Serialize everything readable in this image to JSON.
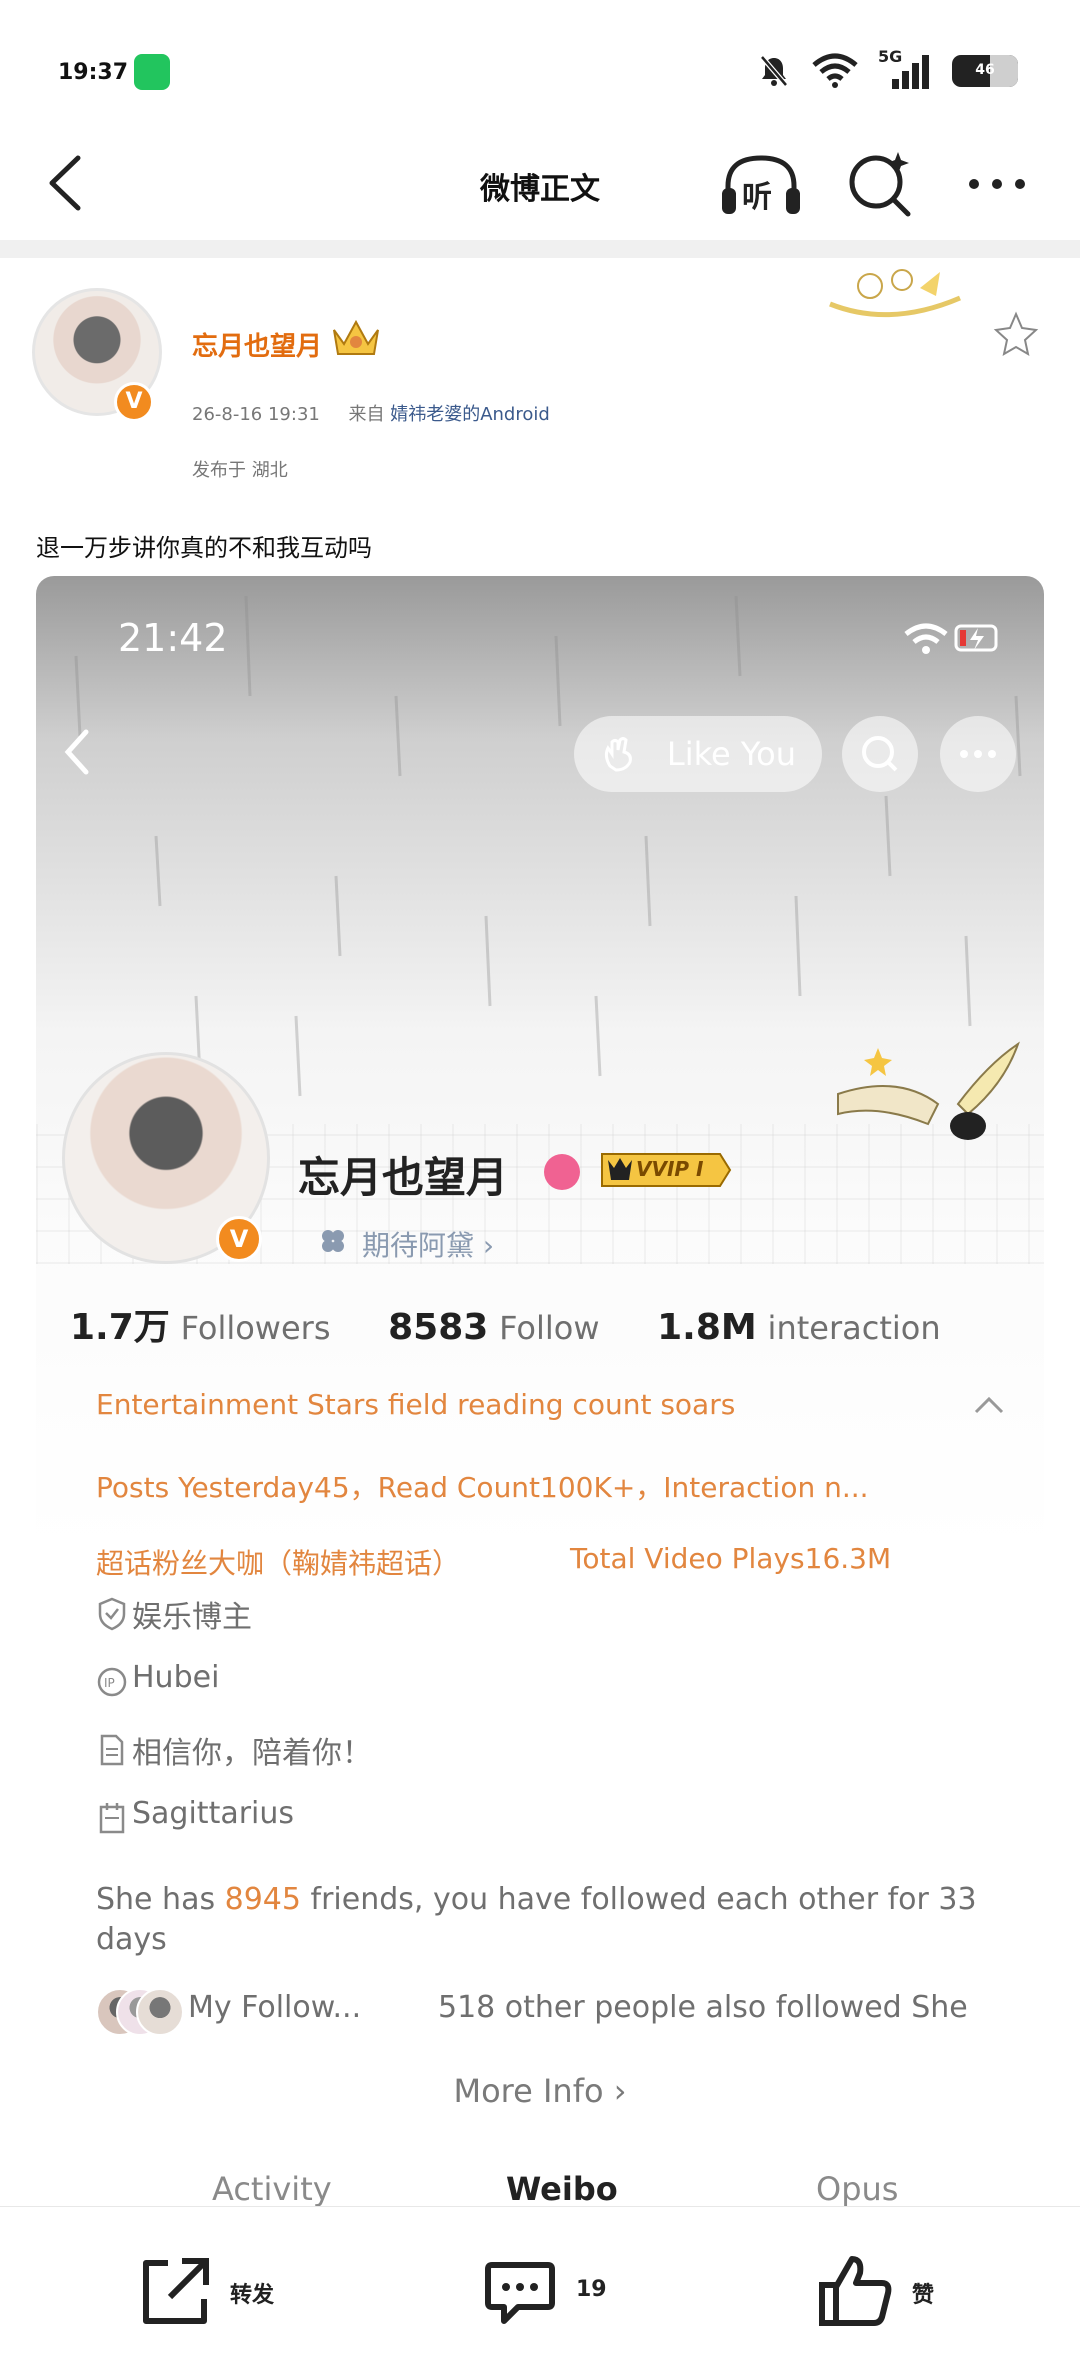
{
  "status_bar": {
    "time": "19:37",
    "network": "5G",
    "battery": "46"
  },
  "nav": {
    "title": "微博正文",
    "listen_label": "听"
  },
  "post": {
    "user_name": "忘月也望月",
    "date": "26-8-16 19:31",
    "from_prefix": "来自",
    "source": "婧祎老婆的Android",
    "location": "发布于 湖北",
    "text": "退一万步讲你真的不和我互动吗"
  },
  "embedded_profile": {
    "time": "21:42",
    "like_you_label": "Like You",
    "name": "忘月也望月",
    "vip_label": "VVIP I",
    "topic": "期待阿黛 ›",
    "stats": {
      "followers_value": "1.7万",
      "followers_label": "Followers",
      "follow_value": "8583",
      "follow_label": "Follow",
      "interaction_value": "1.8M",
      "interaction_label": "interaction"
    },
    "highlight_1": "Entertainment Stars field reading count soars",
    "highlight_2": "Posts Yesterday45，Read Count100K+，Interaction n...",
    "highlight_3a": "超话粉丝大咖（鞠婧祎超话）",
    "highlight_3b": "Total Video Plays16.3M",
    "info_role": "娱乐博主",
    "info_ip": "Hubei",
    "info_bio": "相信你，陪着你！",
    "info_sign": "Sagittarius",
    "friends_pre": "She has ",
    "friends_num": "8945",
    "friends_post": " friends, you have followed each other for 33 days",
    "my_follow": "My Follow...",
    "others_follow": "518 other people also followed She",
    "more_info": "More Info ›",
    "tabs": [
      "Activity",
      "Weibo",
      "Opus"
    ]
  },
  "bottom_bar": {
    "repost_label": "转发",
    "comment_count": "19",
    "like_label": "赞"
  },
  "colors": {
    "accent_orange": "#e2863f",
    "name_orange": "#e26c0f",
    "source_blue": "#3b5a8c",
    "vip_gold": "#f5c542"
  },
  "icons": {
    "nav": [
      "back-arrow-icon",
      "headphones-icon",
      "sparkle-search-icon",
      "more-dots-icon"
    ],
    "bottom": [
      "share-icon",
      "comment-icon",
      "thumbs-up-icon"
    ]
  }
}
